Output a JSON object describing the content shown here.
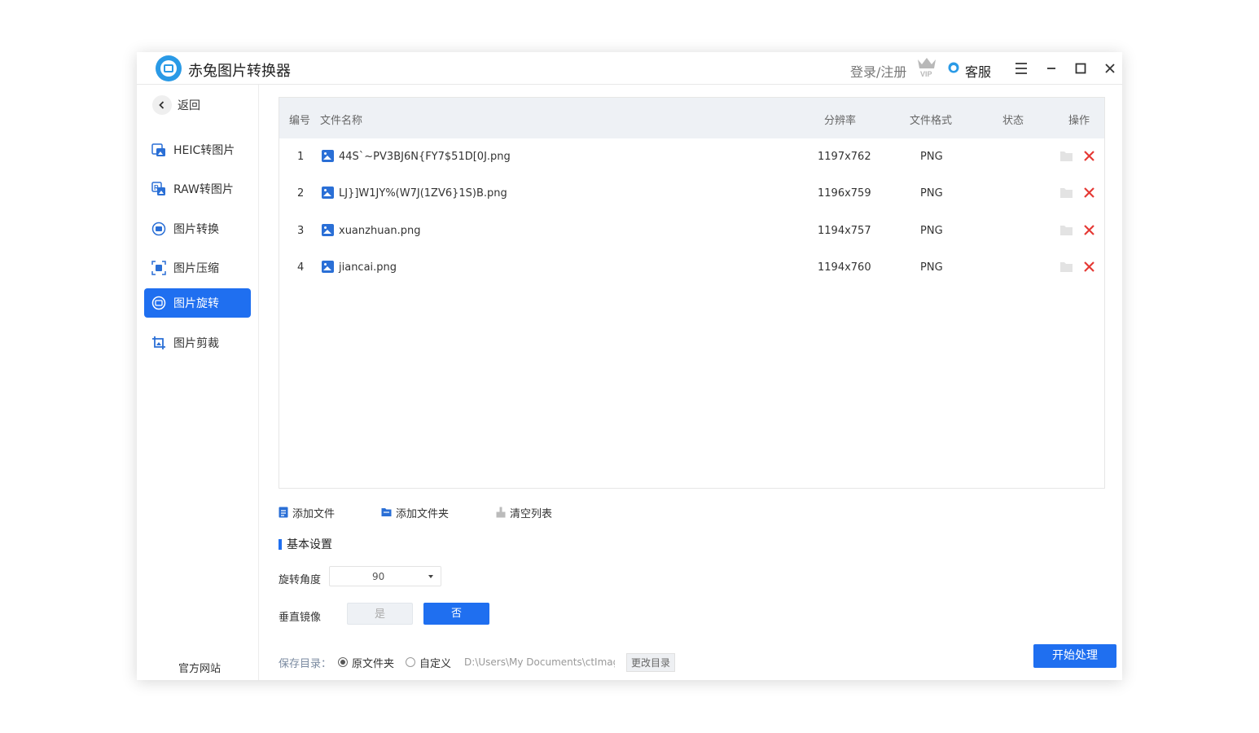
{
  "app": {
    "title": "赤兔图片转换器"
  },
  "header": {
    "login": "登录/注册",
    "vip_icon": "crown-vip-icon",
    "service": "客服"
  },
  "sidebar": {
    "back": "返回",
    "items": [
      {
        "label": "HEIC转图片",
        "icon": "heic-icon"
      },
      {
        "label": "RAW转图片",
        "icon": "raw-icon"
      },
      {
        "label": "图片转换",
        "icon": "convert-icon"
      },
      {
        "label": "图片压缩",
        "icon": "compress-icon"
      },
      {
        "label": "图片旋转",
        "icon": "rotate-icon",
        "active": true
      },
      {
        "label": "图片剪裁",
        "icon": "crop-icon"
      }
    ],
    "official_site": "官方网站"
  },
  "table": {
    "columns": [
      "编号",
      "文件名称",
      "分辨率",
      "文件格式",
      "状态",
      "操作"
    ],
    "rows": [
      {
        "num": "1",
        "name": "44S`~PV3BJ6N{FY7$51D[0J.png",
        "resolution": "1197x762",
        "format": "PNG",
        "status": ""
      },
      {
        "num": "2",
        "name": "LJ}]W1JY%(W7J(1ZV6}1S)B.png",
        "resolution": "1196x759",
        "format": "PNG",
        "status": ""
      },
      {
        "num": "3",
        "name": "xuanzhuan.png",
        "resolution": "1194x757",
        "format": "PNG",
        "status": ""
      },
      {
        "num": "4",
        "name": "jiancai.png",
        "resolution": "1194x760",
        "format": "PNG",
        "status": ""
      }
    ]
  },
  "toolbar": {
    "add_file": "添加文件",
    "add_folder": "添加文件夹",
    "clear_list": "清空列表"
  },
  "settings": {
    "title": "基本设置",
    "rotate_label": "旋转角度",
    "rotate_value": "90",
    "mirror_label": "垂直镜像",
    "mirror_yes": "是",
    "mirror_no": "否",
    "mirror_selected": "否"
  },
  "save": {
    "label": "保存目录：",
    "option_original": "原文件夹",
    "option_custom": "自定义",
    "selected": "原文件夹",
    "path": "D:\\Users\\My Documents\\ctImageC",
    "change_dir": "更改目录"
  },
  "start_button": "开始处理",
  "colors": {
    "accent": "#1f6ff0",
    "delete": "#e53935",
    "header_bg": "#eef1f5"
  }
}
